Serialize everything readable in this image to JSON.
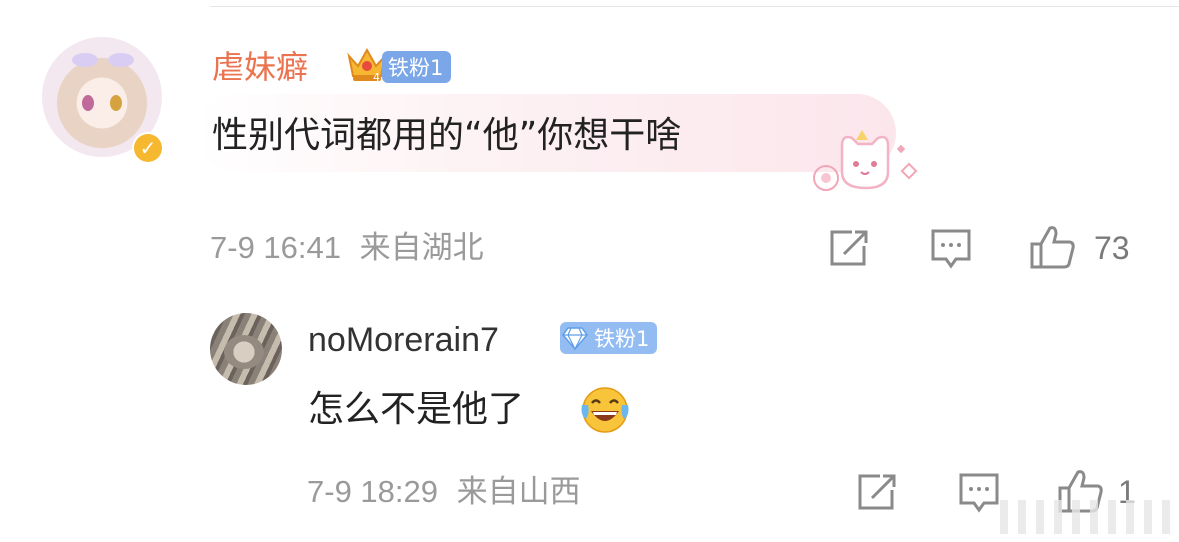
{
  "comment": {
    "user_name": "虐妹癖",
    "fan_badge": "铁粉1",
    "crown_level": "4",
    "text": "性别代词都用的“他”你想干啥",
    "timestamp": "7-9 16:41",
    "location": "来自湖北",
    "like_count": "73",
    "verified_icon": "v-verified-icon",
    "sticker_icon": "cat-sticker-icon"
  },
  "reply": {
    "user_name": "noMorerain7",
    "fan_badge": "铁粉1",
    "text": "怎么不是他了",
    "emoji_icon": "laughing-tears-emoji",
    "timestamp": "7-9 18:29",
    "location": "来自山西",
    "like_count": "1"
  },
  "colors": {
    "name_orange": "#eb7350",
    "badge_blue": "#7ba7e8",
    "meta_gray": "#9a9a9a",
    "verified_yellow": "#f5b82e"
  }
}
